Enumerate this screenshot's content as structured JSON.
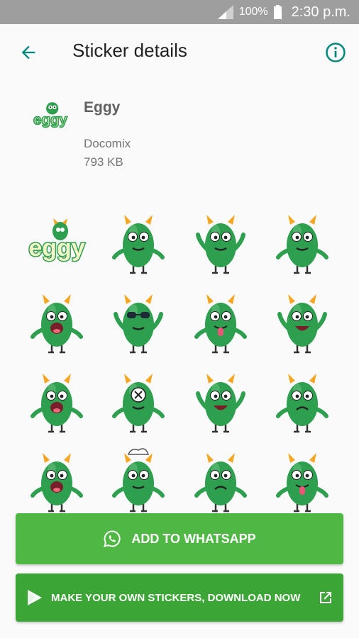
{
  "status_bar": {
    "battery": "100%",
    "time": "2:30 p.m."
  },
  "app_bar": {
    "title": "Sticker details",
    "back_icon": "arrow-back-icon",
    "info_icon": "info-icon"
  },
  "pack": {
    "name": "Eggy",
    "publisher": "Docomix",
    "size": "793 KB"
  },
  "stickers": [
    {
      "kind": "logo",
      "text": "eggy"
    },
    {
      "kind": "monster",
      "mood": "plain"
    },
    {
      "kind": "monster",
      "mood": "wave"
    },
    {
      "kind": "monster",
      "mood": "smirk"
    },
    {
      "kind": "monster",
      "mood": "shout"
    },
    {
      "kind": "monster",
      "mood": "cool"
    },
    {
      "kind": "monster",
      "mood": "tongue"
    },
    {
      "kind": "monster",
      "mood": "happy"
    },
    {
      "kind": "monster",
      "mood": "scared"
    },
    {
      "kind": "monster",
      "mood": "dizzy"
    },
    {
      "kind": "monster",
      "mood": "cheer"
    },
    {
      "kind": "monster",
      "mood": "sad"
    },
    {
      "kind": "monster",
      "mood": "laugh"
    },
    {
      "kind": "monster",
      "mood": "chef"
    },
    {
      "kind": "monster",
      "mood": "worried"
    },
    {
      "kind": "monster",
      "mood": "silly"
    }
  ],
  "buttons": {
    "add_label": "ADD TO WHATSAPP",
    "make_label": "MAKE YOUR OWN STICKERS, DOWNLOAD NOW"
  },
  "colors": {
    "accent": "#00897b",
    "button_green": "#4fb845",
    "button_green_dark": "#3ba635",
    "monster_green": "#2e9e4f"
  }
}
